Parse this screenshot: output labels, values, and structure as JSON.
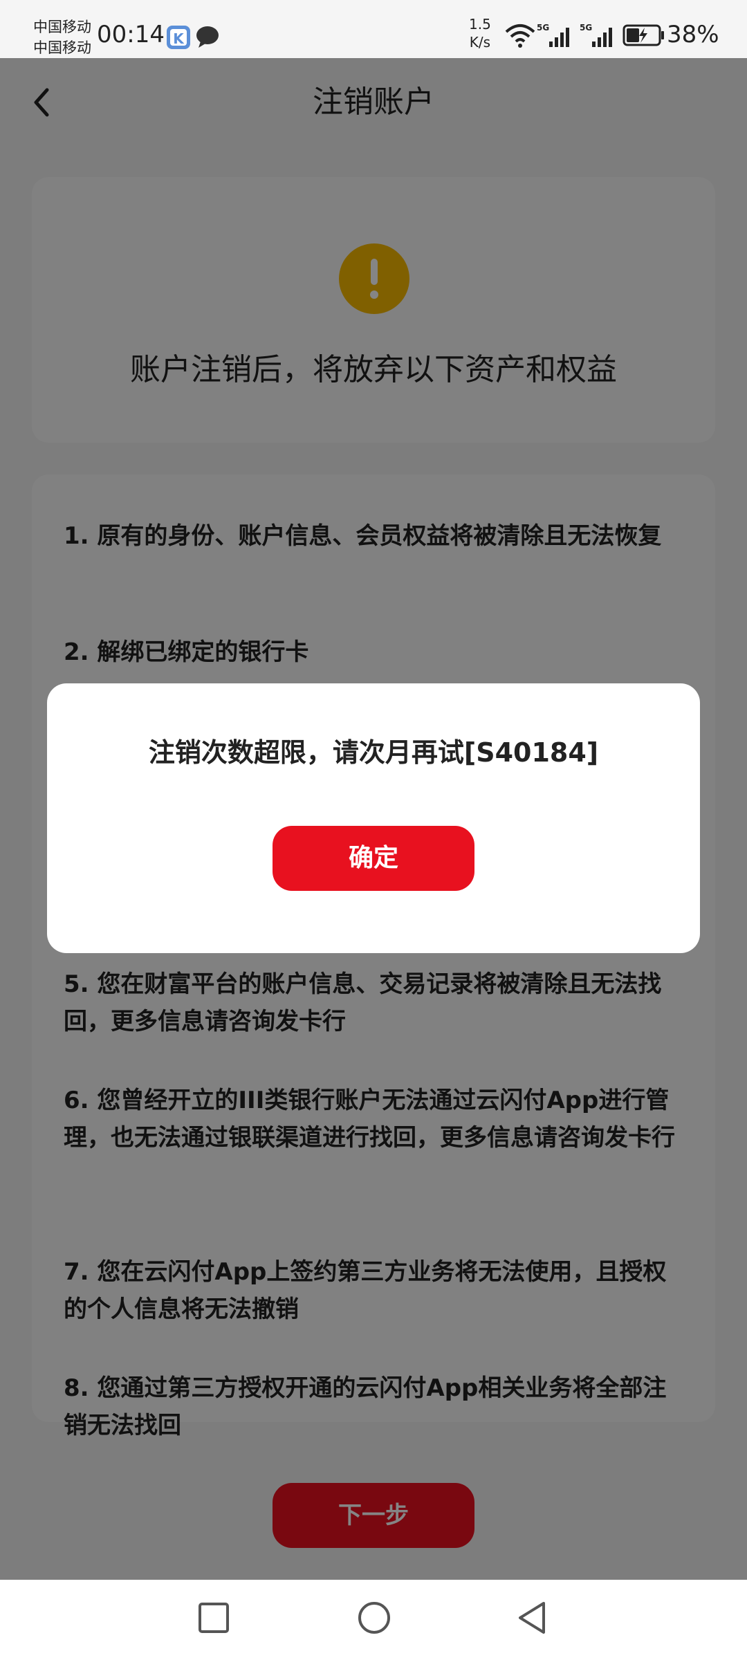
{
  "status_bar": {
    "carrier_1": "中国移动",
    "carrier_2": "中国移动",
    "time": "00:14",
    "net_speed_value": "1.5",
    "net_speed_unit": "K/s",
    "signal_1_label": "5G",
    "signal_2_label": "5G",
    "battery": "38%",
    "icons": [
      "k-app-icon",
      "chat-bubble-icon",
      "wifi-icon",
      "signal-icon",
      "signal-icon",
      "battery-icon"
    ]
  },
  "header": {
    "title": "注销账户",
    "back_icon": "chevron-left-icon"
  },
  "warning": {
    "icon": "exclamation-icon",
    "icon_color": "#f6b800",
    "heading": "账户注销后，将放弃以下资产和权益"
  },
  "terms": {
    "items": [
      "1. 原有的身份、账户信息、会员权益将被清除且无法恢复",
      "2. 解绑已绑定的银行卡",
      "5. 您在财富平台的账户信息、交易记录将被清除且无法找回，更多信息请咨询发卡行",
      "6. 您曾经开立的III类银行账户无法通过云闪付App进行管理，也无法通过银联渠道进行找回，更多信息请咨询发卡行",
      "7. 您在云闪付App上签约第三方业务将无法使用，且授权的个人信息将无法撤销",
      "8. 您通过第三方授权开通的云闪付App相关业务将全部注销无法找回"
    ]
  },
  "footer": {
    "next_label": "下一步"
  },
  "dialog": {
    "message": "注销次数超限，请次月再试[S40184]",
    "confirm_label": "确定"
  },
  "colors": {
    "accent": "#e8111f",
    "warning": "#f6b800"
  },
  "nav_bar": {
    "icons": [
      "square-icon",
      "circle-icon",
      "triangle-back-icon"
    ]
  }
}
